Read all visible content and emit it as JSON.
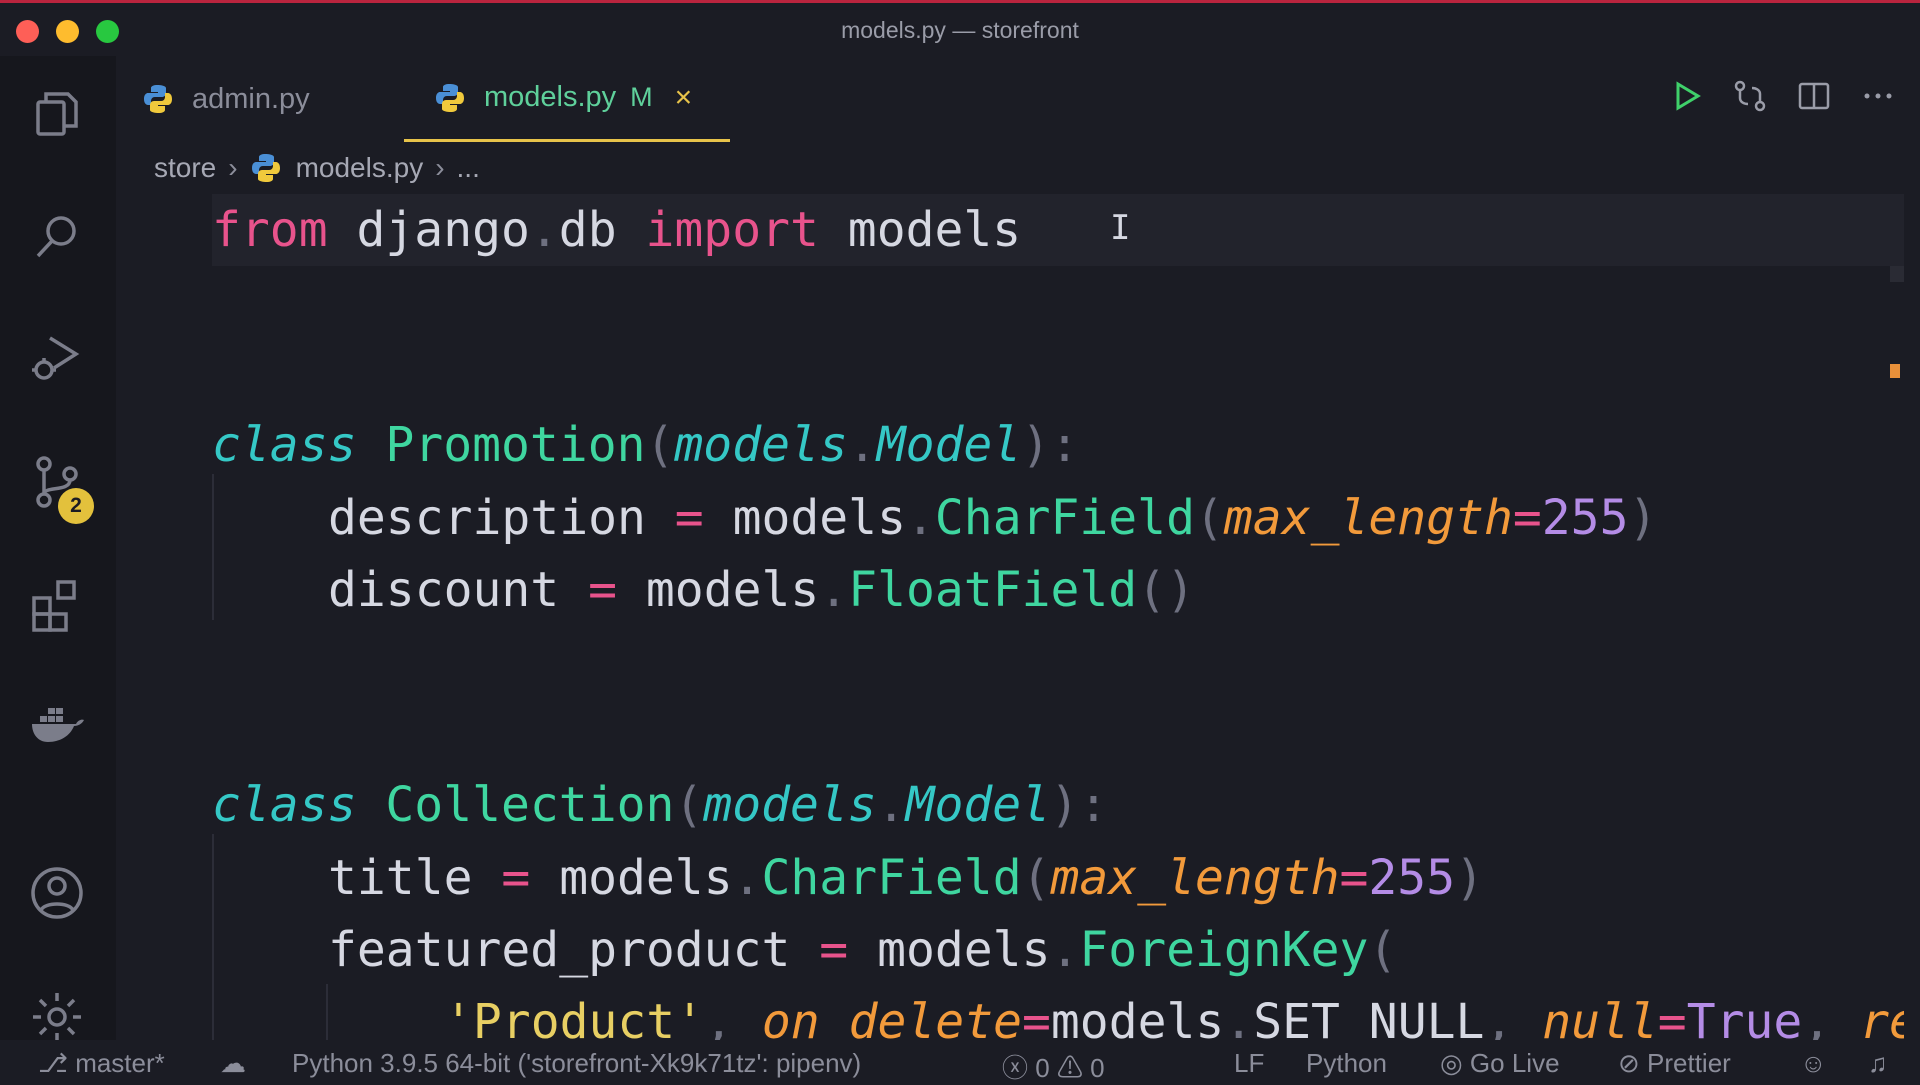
{
  "window": {
    "title": "models.py — storefront"
  },
  "tabs": [
    {
      "label": "admin.py",
      "active": false
    },
    {
      "label": "models.py",
      "active": true,
      "modified": "M",
      "close": "×"
    }
  ],
  "breadcrumb": {
    "folder": "store",
    "file": "models.py",
    "tail": "..."
  },
  "activity_bar": {
    "icons": [
      "explorer-icon",
      "search-icon",
      "run-debug-icon",
      "source-control-icon",
      "extensions-icon",
      "docker-icon",
      "account-icon",
      "settings-gear-icon"
    ],
    "source_control_badge": "2"
  },
  "editor_actions": [
    "run-icon",
    "compare-changes-icon",
    "split-editor-icon",
    "more-actions-icon"
  ],
  "code": {
    "line1": {
      "kw1": "from",
      "mod": " django",
      "dot": ".",
      "sub": "db ",
      "kw2": "import",
      "name": " models"
    },
    "promotion": {
      "kw": "class",
      "name": " Promotion",
      "p1": "(",
      "base_mod": "models",
      "dot": ".",
      "base_cls": "Model",
      "p2": "):"
    },
    "description": {
      "name": "description ",
      "eq": "=",
      "mod": " models",
      "dot": ".",
      "fn": "CharField",
      "p1": "(",
      "param": "max_length",
      "peq": "=",
      "num": "255",
      "p2": ")"
    },
    "discount": {
      "name": "discount ",
      "eq": "=",
      "mod": " models",
      "dot": ".",
      "fn": "FloatField",
      "p1": "()"
    },
    "collection": {
      "kw": "class",
      "name": " Collection",
      "p1": "(",
      "base_mod": "models",
      "dot": ".",
      "base_cls": "Model",
      "p2": "):"
    },
    "title": {
      "name": "title ",
      "eq": "=",
      "mod": " models",
      "dot": ".",
      "fn": "CharField",
      "p1": "(",
      "param": "max_length",
      "peq": "=",
      "num": "255",
      "p2": ")"
    },
    "featured": {
      "name": "featured_product ",
      "eq": "=",
      "mod": " models",
      "dot": ".",
      "fn": "ForeignKey",
      "p1": "("
    },
    "fk_args": {
      "q1": "'",
      "str": "Product",
      "q2": "'",
      "comma": ", ",
      "param1": "on_delete",
      "eq1": "=",
      "mod": "models",
      "dot": ".",
      "const": "SET_NULL",
      "comma2": ", ",
      "param2": "null",
      "eq2": "=",
      "val": "True",
      "comma3": ", ",
      "param3": "re"
    }
  },
  "status_bar": {
    "branch": "master*",
    "interpreter": "Python 3.9.5 64-bit ('storefront-Xk9k71tz': pipenv)",
    "errors": "0",
    "warnings": "0",
    "eol": "LF",
    "language": "Python",
    "go_live": "Go Live",
    "prettier": "Prettier"
  }
}
